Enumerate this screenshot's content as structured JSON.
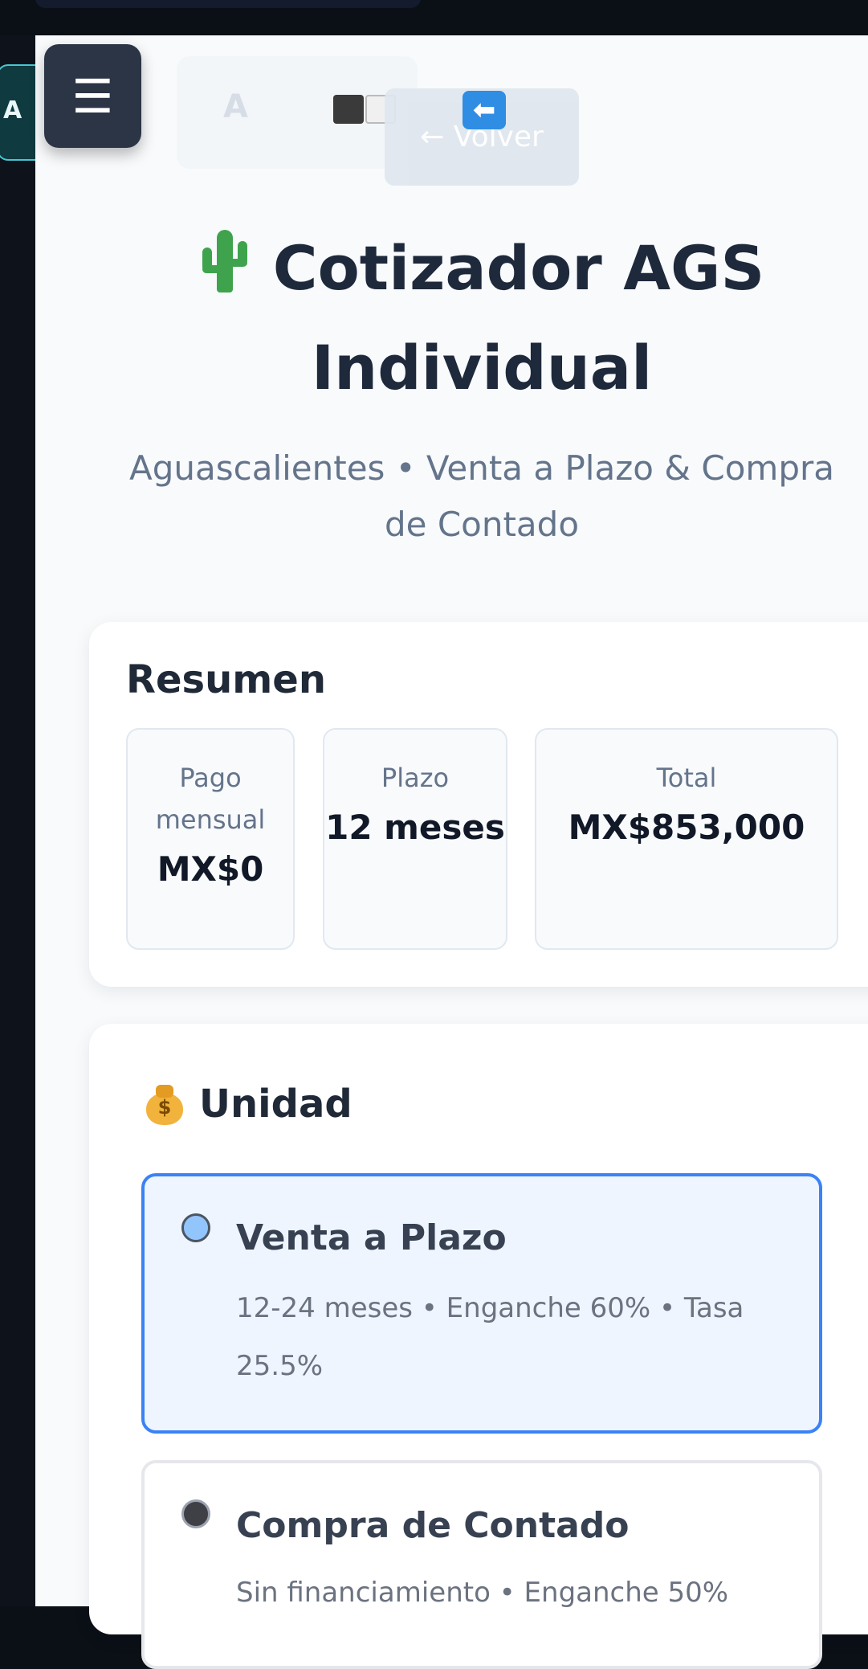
{
  "sidebar_tab": {
    "label": "A"
  },
  "toolbar": {
    "font_toggle_label": "A",
    "back_button_label": "← Volver",
    "back_icon": "⬅"
  },
  "header": {
    "title": "Cotizador AGS Individual",
    "subtitle": "Aguascalientes • Venta a Plazo & Compra de Contado"
  },
  "summary": {
    "title": "Resumen",
    "stats": [
      {
        "label": "Pago mensual",
        "value": "MX$0"
      },
      {
        "label": "Plazo",
        "value": "12 meses"
      },
      {
        "label": "Total",
        "value": "MX$853,000"
      }
    ]
  },
  "unit": {
    "title": "Unidad",
    "options": [
      {
        "title": "Venta a Plazo",
        "description": "12-24 meses • Enganche 60% • Tasa 25.5%",
        "selected": true
      },
      {
        "title": "Compra de Contado",
        "description": "Sin financiamiento • Enganche 50%",
        "selected": false
      }
    ]
  },
  "colors": {
    "accent": "#3b82f6",
    "title": "#1e293b",
    "muted": "#64748b",
    "menu_button": "#2c3546"
  },
  "icons": [
    "menu-icon",
    "font-size-icon",
    "contrast-icon",
    "back-arrow-icon",
    "cactus-icon",
    "money-bag-icon"
  ]
}
